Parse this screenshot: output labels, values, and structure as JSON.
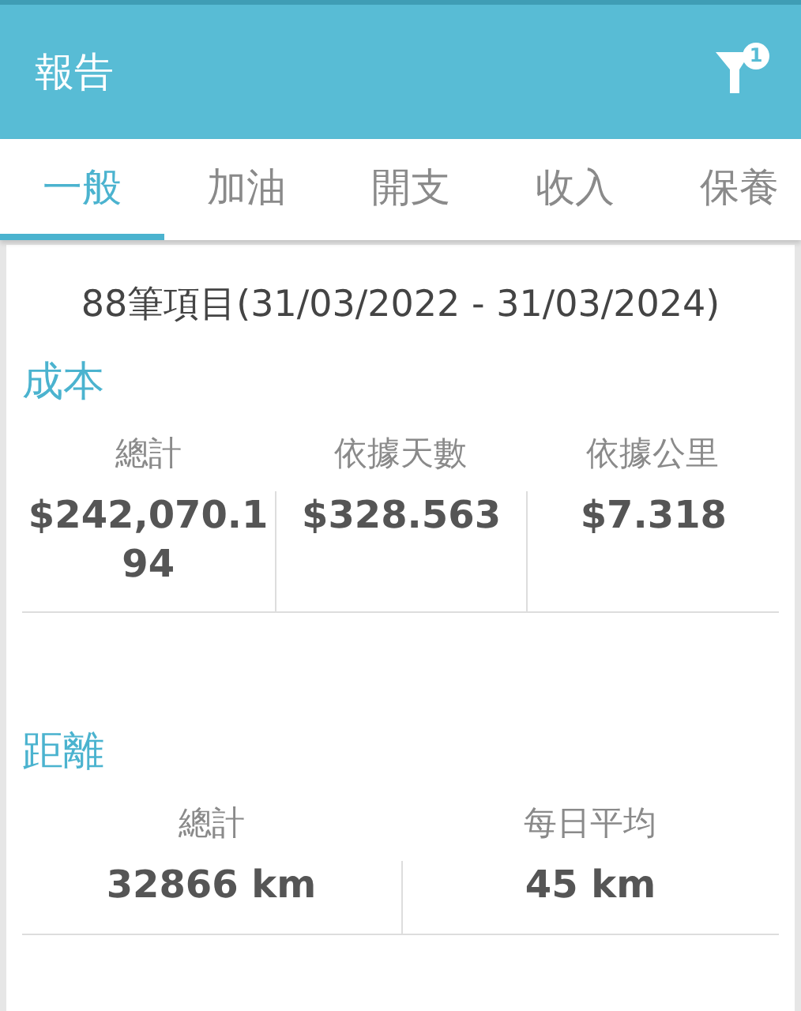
{
  "app_bar": {
    "title": "報告",
    "filter_badge": "1"
  },
  "tabs": [
    {
      "label": "一般",
      "selected": true
    },
    {
      "label": "加油",
      "selected": false
    },
    {
      "label": "開支",
      "selected": false
    },
    {
      "label": "收入",
      "selected": false
    },
    {
      "label": "保養",
      "selected": false
    }
  ],
  "summary": "88筆項目(31/03/2022 - 31/03/2024)",
  "sections": [
    {
      "title": "成本",
      "stats": [
        {
          "label": "總計",
          "value": "$242,070.194"
        },
        {
          "label": "依據天數",
          "value": "$328.563"
        },
        {
          "label": "依據公里",
          "value": "$7.318"
        }
      ]
    },
    {
      "title": "距離",
      "stats": [
        {
          "label": "總計",
          "value": "32866 km"
        },
        {
          "label": "每日平均",
          "value": "45 km"
        }
      ]
    }
  ]
}
